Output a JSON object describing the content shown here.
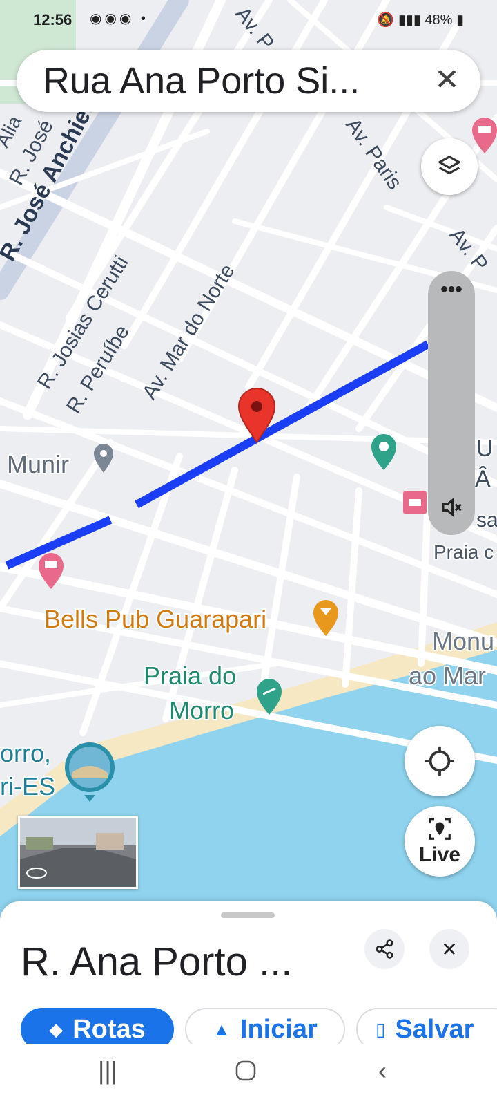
{
  "status_bar": {
    "time": "12:56",
    "battery": "48%"
  },
  "search": {
    "title": "Rua Ana Porto Si...",
    "close": "✕"
  },
  "streets": [
    "R. José Anchieta",
    "R. José",
    "Alia",
    "R. Josias Cerutti",
    "R. Peruíbe",
    "Av. Mar do Norte",
    "Av. Paris",
    "Av. P",
    "Av. P"
  ],
  "pois": {
    "munir": "Munir",
    "bells": "Bells Pub Guarapari",
    "praia_do_morro_line1": "Praia do",
    "praia_do_morro_line2": "Morro",
    "morro_line1": "orro,",
    "morro_line2": "ri-ES",
    "monumento_line1": "Monu",
    "monumento_line2": "ao Mar",
    "praia_c": "Praia c",
    "right_cut_1": "U",
    "right_cut_2": "Â",
    "right_cut_3": "sa"
  },
  "side_panel": {
    "more": "•••"
  },
  "live_button": {
    "label": "Live"
  },
  "sheet": {
    "title": "R. Ana Porto ...",
    "share": "share",
    "close": "✕",
    "actions": {
      "rotas": "Rotas",
      "iniciar": "Iniciar",
      "salvar": "Salvar"
    }
  },
  "colors": {
    "route": "#1a3ef5",
    "water": "#8fd3ee",
    "beach": "#f6e8c3",
    "pin": "#e8342a",
    "lodging": "#e8698a",
    "food": "#e8981c",
    "park": "#2fa38a",
    "accent": "#1a73e8"
  }
}
